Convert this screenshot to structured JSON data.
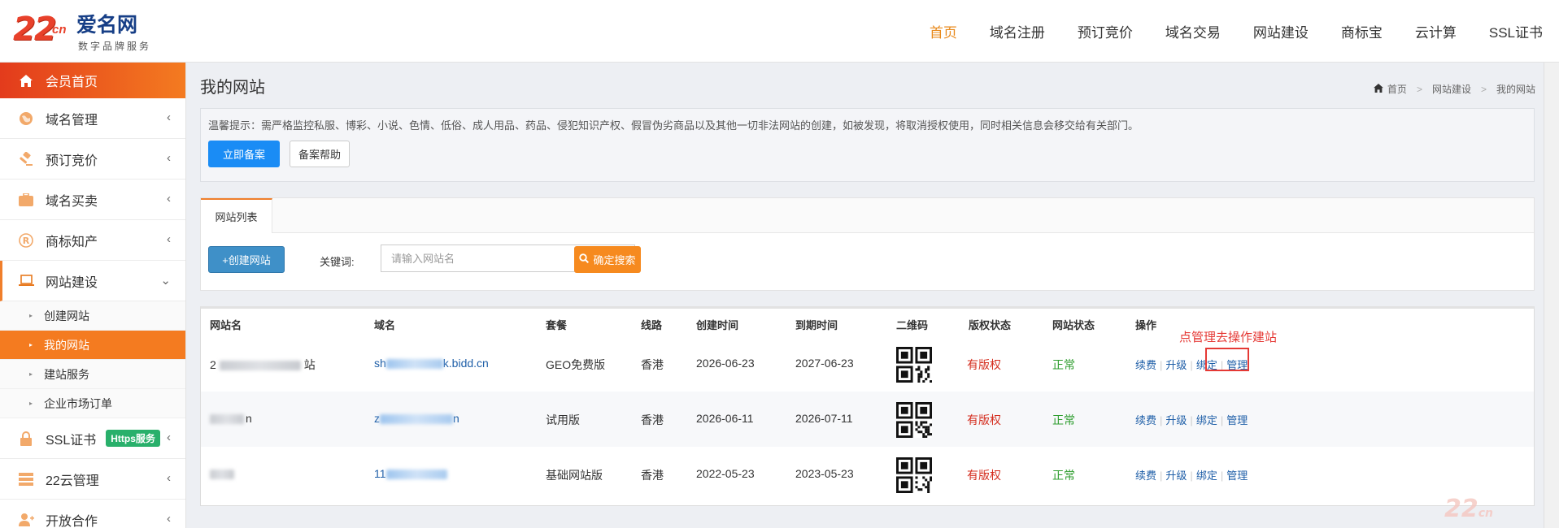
{
  "header": {
    "logo": {
      "main": "22",
      "cn": "cn",
      "name": "爱名网",
      "sub": "数字品牌服务"
    },
    "nav": [
      "首页",
      "域名注册",
      "预订竞价",
      "域名交易",
      "网站建设",
      "商标宝",
      "云计算",
      "SSL证书"
    ],
    "nav_active": "首页"
  },
  "sidebar": {
    "items": [
      {
        "label": "会员首页",
        "icon": "home-icon"
      },
      {
        "label": "域名管理",
        "icon": "globe-icon"
      },
      {
        "label": "预订竞价",
        "icon": "gavel-icon"
      },
      {
        "label": "域名买卖",
        "icon": "briefcase-icon"
      },
      {
        "label": "商标知产",
        "icon": "registered-icon"
      },
      {
        "label": "网站建设",
        "icon": "laptop-icon"
      },
      {
        "label": "SSL证书",
        "icon": "lock-icon",
        "badge": "Https服务"
      },
      {
        "label": "22云管理",
        "icon": "server-icon"
      },
      {
        "label": "开放合作",
        "icon": "user-plus-icon"
      }
    ],
    "sub_items": [
      "创建网站",
      "我的网站",
      "建站服务",
      "企业市场订单"
    ]
  },
  "content": {
    "title": "我的网站",
    "breadcrumb": [
      "首页",
      "网站建设",
      "我的网站"
    ],
    "notice": "温馨提示：需严格监控私服、博彩、小说、色情、低俗、成人用品、药品、侵犯知识产权、假冒伪劣商品以及其他一切非法网站的创建，如被发现，将取消授权使用，同时相关信息会移交给有关部门。",
    "btn_record": "立即备案",
    "btn_help": "备案帮助",
    "tab": "网站列表",
    "btn_create": "+创建网站",
    "keyword_label": "关键词:",
    "search_placeholder": "请输入网站名",
    "btn_search": "确定搜索"
  },
  "table": {
    "headers": [
      "网站名",
      "域名",
      "套餐",
      "线路",
      "创建时间",
      "到期时间",
      "二维码",
      "版权状态",
      "网站状态",
      "操作"
    ],
    "rows": [
      {
        "name_prefix": "2",
        "name_suffix": "站",
        "domain_prefix": "sh",
        "domain_suffix": "k.bidd.cn",
        "plan": "GEO免费版",
        "line": "香港",
        "created": "2026-06-23",
        "expires": "2027-06-23",
        "copyright": "有版权",
        "status": "正常"
      },
      {
        "name_prefix": "",
        "name_suffix": "n",
        "domain_prefix": "z",
        "domain_suffix": "n",
        "plan": "试用版",
        "line": "香港",
        "created": "2026-06-11",
        "expires": "2026-07-11",
        "copyright": "有版权",
        "status": "正常"
      },
      {
        "name_prefix": "",
        "name_suffix": "",
        "domain_prefix": "11",
        "domain_suffix": "",
        "plan": "基础网站版",
        "line": "香港",
        "created": "2022-05-23",
        "expires": "2023-05-23",
        "copyright": "有版权",
        "status": "正常"
      }
    ],
    "ops": [
      "续费",
      "升级",
      "绑定",
      "管理"
    ],
    "annotation": "点管理去操作建站"
  },
  "watermark": "22cn"
}
